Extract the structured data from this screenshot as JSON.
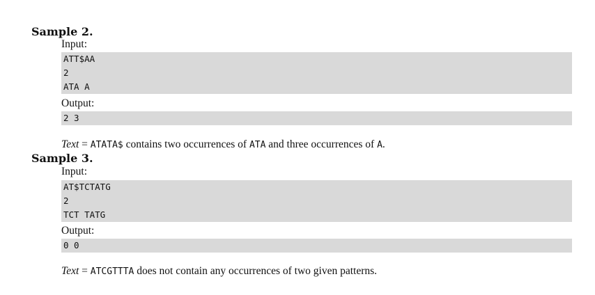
{
  "samples": [
    {
      "title": "Sample 2.",
      "input_label": "Input:",
      "input_lines": [
        "ATT$AA",
        "2",
        "ATA A"
      ],
      "output_label": "Output:",
      "output_lines": [
        "2 3"
      ],
      "note": {
        "var": "Text",
        "eq": " = ",
        "text_value": "ATATA$",
        "t1": " contains two occurrences of ",
        "p1": "ATA",
        "t2": " and three occurrences of ",
        "p2": "A",
        "t3": "."
      }
    },
    {
      "title": "Sample 3.",
      "input_label": "Input:",
      "input_lines": [
        "AT$TCTATG",
        "2",
        "TCT TATG"
      ],
      "output_label": "Output:",
      "output_lines": [
        "0 0"
      ],
      "note": {
        "var": "Text",
        "eq": " = ",
        "text_value": "ATCGTTTA",
        "t1": " does not contain any occurrences of two given patterns."
      }
    }
  ]
}
